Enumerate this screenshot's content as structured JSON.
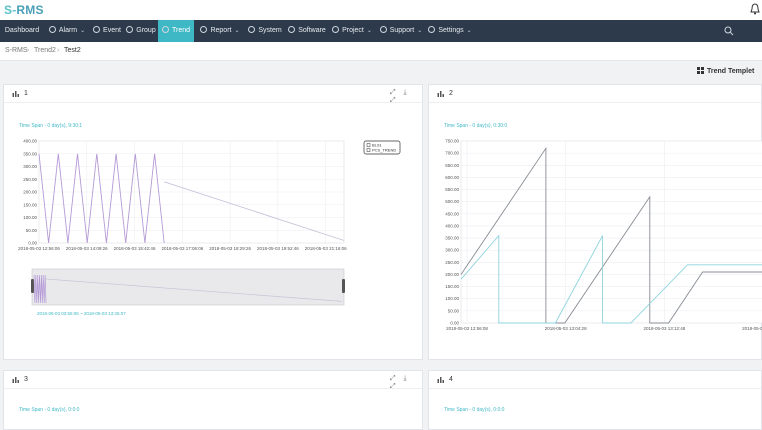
{
  "app": {
    "logo_s": "S-",
    "logo_rms": "RMS"
  },
  "nav": {
    "items": [
      {
        "label": "Dashboard",
        "chevron": false
      },
      {
        "label": "Alarm",
        "chevron": true
      },
      {
        "label": "Event",
        "chevron": false
      },
      {
        "label": "Group",
        "chevron": false
      },
      {
        "label": "Trend",
        "chevron": false,
        "active": true
      },
      {
        "label": "Report",
        "chevron": true
      },
      {
        "label": "System",
        "chevron": false
      },
      {
        "label": "Software",
        "chevron": false
      },
      {
        "label": "Project",
        "chevron": true
      },
      {
        "label": "Support",
        "chevron": true
      },
      {
        "label": "Settings",
        "chevron": true
      }
    ],
    "chevron_glyph": "⌄"
  },
  "breadcrumb": {
    "items": [
      "S-RMS",
      "Trend2",
      "Test2"
    ],
    "separator": "›"
  },
  "toolbar": {
    "trend_templet_label": "Trend Templet"
  },
  "panels": [
    {
      "id": "1",
      "title": "1",
      "time_span": "Time Span - 0 day(s), 9:30:1",
      "tools": "⤢ ⤓ ⤢",
      "chart_data": {
        "type": "line",
        "ylim": [
          0,
          400
        ],
        "yticks": [
          "0.00",
          "50.00",
          "100.00",
          "150.00",
          "200.00",
          "250.00",
          "300.00",
          "350.00",
          "400.00"
        ],
        "xticks": [
          "2018-05-03 12:56:06",
          "2018-05-03 14:09:26",
          "2018-05-03 15:42:46",
          "2018-05-03 17:06:06",
          "2018-05-03 18:29:26",
          "2018-05-03 19:52:46",
          "2018-05-03 21:16:06"
        ],
        "legend": [
          "BLS1",
          "PCS_TREND"
        ],
        "series": [
          {
            "name": "BLS1",
            "color": "#b59ad6",
            "x": [
              0,
              0.3,
              0.6,
              0.9,
              1.2,
              1.5,
              1.8,
              2.1,
              2.4,
              2.7,
              3.0,
              3.3,
              3.6,
              3.9
            ],
            "y": [
              350,
              0,
              350,
              0,
              350,
              0,
              350,
              0,
              350,
              0,
              350,
              0,
              350,
              0
            ]
          },
          {
            "name": "PCS_TREND",
            "color": "#c9c3d8",
            "x": [
              3.9,
              9.5
            ],
            "y": [
              240,
              10
            ]
          }
        ],
        "xlim": [
          0,
          9.5
        ],
        "navigator": {
          "range_text": "2018-05-03 03:55:06 ~ 2018-05-03 13:26:07"
        }
      }
    },
    {
      "id": "2",
      "title": "2",
      "time_span": "Time Span - 0 day(s), 0:30:0",
      "chart_data": {
        "type": "line",
        "ylim": [
          0,
          750
        ],
        "yticks": [
          "0.00",
          "50.00",
          "100.00",
          "150.00",
          "200.00",
          "250.00",
          "300.00",
          "350.00",
          "400.00",
          "450.00",
          "500.00",
          "550.00",
          "600.00",
          "650.00",
          "700.00",
          "750.00"
        ],
        "xticks": [
          "2018-05-03 12:56:08",
          "2018-05-03 13:04:28",
          "2018-05-03 13:12:48",
          "2018-05-03 13:21:08"
        ],
        "xlim": [
          0,
          1.6
        ],
        "series": [
          {
            "name": "",
            "color": "#888c94",
            "x": [
              0,
              0.45,
              0.45,
              0.55,
              1.0,
              1.0,
              1.1,
              1.28,
              1.28,
              1.6
            ],
            "y": [
              200,
              720,
              0,
              0,
              520,
              0,
              0,
              210,
              210,
              210
            ]
          },
          {
            "name": "",
            "color": "#8fd4dc",
            "x": [
              0.0,
              0.2,
              0.2,
              0.5,
              0.75,
              0.75,
              0.9,
              1.2,
              1.2,
              1.6
            ],
            "y": [
              180,
              360,
              0,
              0,
              360,
              0,
              0,
              240,
              240,
              240
            ]
          }
        ]
      }
    },
    {
      "id": "3",
      "title": "3",
      "time_span": "Time Span - 0 day(s), 0:0:0",
      "tools": "⤢ ⤓ ⤢"
    },
    {
      "id": "4",
      "title": "4",
      "time_span": "Time Span - 0 day(s), 0:0:0"
    }
  ],
  "colors": {
    "accent": "#3fb8c6",
    "navbar": "#2d3a4b"
  }
}
